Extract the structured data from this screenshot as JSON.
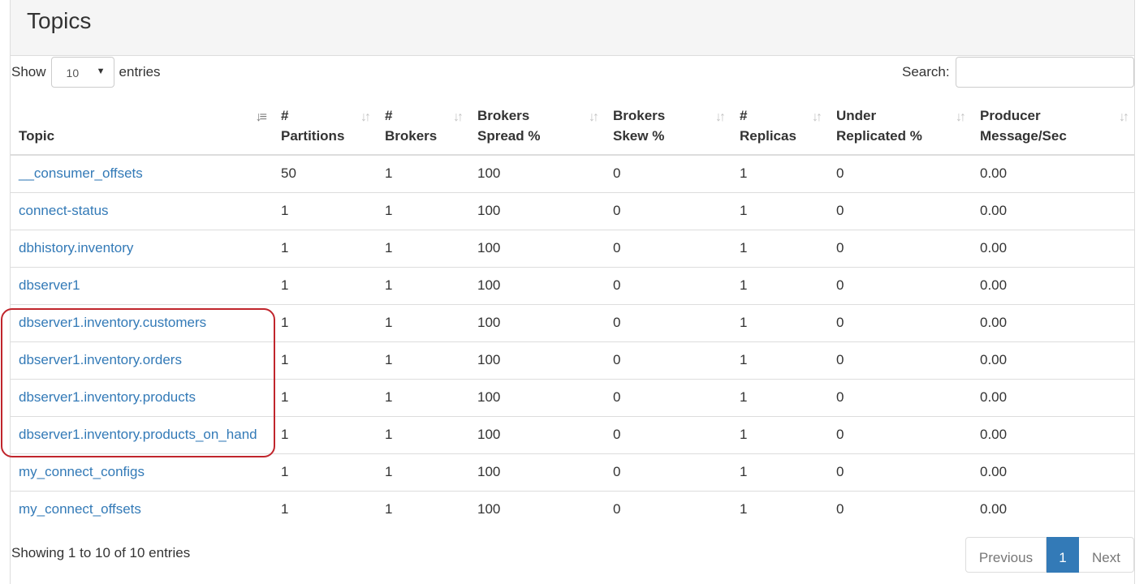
{
  "panel": {
    "title": "Topics"
  },
  "length_control": {
    "show_label": "Show",
    "selected": "10",
    "entries_label": "entries"
  },
  "search": {
    "label": "Search:",
    "value": "",
    "placeholder": ""
  },
  "table": {
    "headers": [
      {
        "line1": "",
        "line2": "Topic"
      },
      {
        "line1": "#",
        "line2": "Partitions"
      },
      {
        "line1": "#",
        "line2": "Brokers"
      },
      {
        "line1": "Brokers",
        "line2": "Spread %"
      },
      {
        "line1": "Brokers",
        "line2": "Skew %"
      },
      {
        "line1": "#",
        "line2": "Replicas"
      },
      {
        "line1": "Under",
        "line2": "Replicated %"
      },
      {
        "line1": "Producer",
        "line2": "Message/Sec"
      }
    ],
    "sorted_column": "Topic",
    "rows": [
      {
        "topic": "__consumer_offsets",
        "partitions": "50",
        "brokers": "1",
        "spread": "100",
        "skew": "0",
        "replicas": "1",
        "under_replicated": "0",
        "msg_sec": "0.00"
      },
      {
        "topic": "connect-status",
        "partitions": "1",
        "brokers": "1",
        "spread": "100",
        "skew": "0",
        "replicas": "1",
        "under_replicated": "0",
        "msg_sec": "0.00"
      },
      {
        "topic": "dbhistory.inventory",
        "partitions": "1",
        "brokers": "1",
        "spread": "100",
        "skew": "0",
        "replicas": "1",
        "under_replicated": "0",
        "msg_sec": "0.00"
      },
      {
        "topic": "dbserver1",
        "partitions": "1",
        "brokers": "1",
        "spread": "100",
        "skew": "0",
        "replicas": "1",
        "under_replicated": "0",
        "msg_sec": "0.00"
      },
      {
        "topic": "dbserver1.inventory.customers",
        "partitions": "1",
        "brokers": "1",
        "spread": "100",
        "skew": "0",
        "replicas": "1",
        "under_replicated": "0",
        "msg_sec": "0.00"
      },
      {
        "topic": "dbserver1.inventory.orders",
        "partitions": "1",
        "brokers": "1",
        "spread": "100",
        "skew": "0",
        "replicas": "1",
        "under_replicated": "0",
        "msg_sec": "0.00"
      },
      {
        "topic": "dbserver1.inventory.products",
        "partitions": "1",
        "brokers": "1",
        "spread": "100",
        "skew": "0",
        "replicas": "1",
        "under_replicated": "0",
        "msg_sec": "0.00"
      },
      {
        "topic": "dbserver1.inventory.products_on_hand",
        "partitions": "1",
        "brokers": "1",
        "spread": "100",
        "skew": "0",
        "replicas": "1",
        "under_replicated": "0",
        "msg_sec": "0.00"
      },
      {
        "topic": "my_connect_configs",
        "partitions": "1",
        "brokers": "1",
        "spread": "100",
        "skew": "0",
        "replicas": "1",
        "under_replicated": "0",
        "msg_sec": "0.00"
      },
      {
        "topic": "my_connect_offsets",
        "partitions": "1",
        "brokers": "1",
        "spread": "100",
        "skew": "0",
        "replicas": "1",
        "under_replicated": "0",
        "msg_sec": "0.00"
      }
    ]
  },
  "footer": {
    "info": "Showing 1 to 10 of 10 entries",
    "previous_label": "Previous",
    "current_page": "1",
    "next_label": "Next"
  },
  "colors": {
    "link": "#337ab7",
    "highlight_border": "#c0252c",
    "active_page": "#337ab7"
  },
  "icons": {
    "sorted_column": "sort-alpha-asc-icon",
    "other_columns": "sort-both-icon"
  }
}
